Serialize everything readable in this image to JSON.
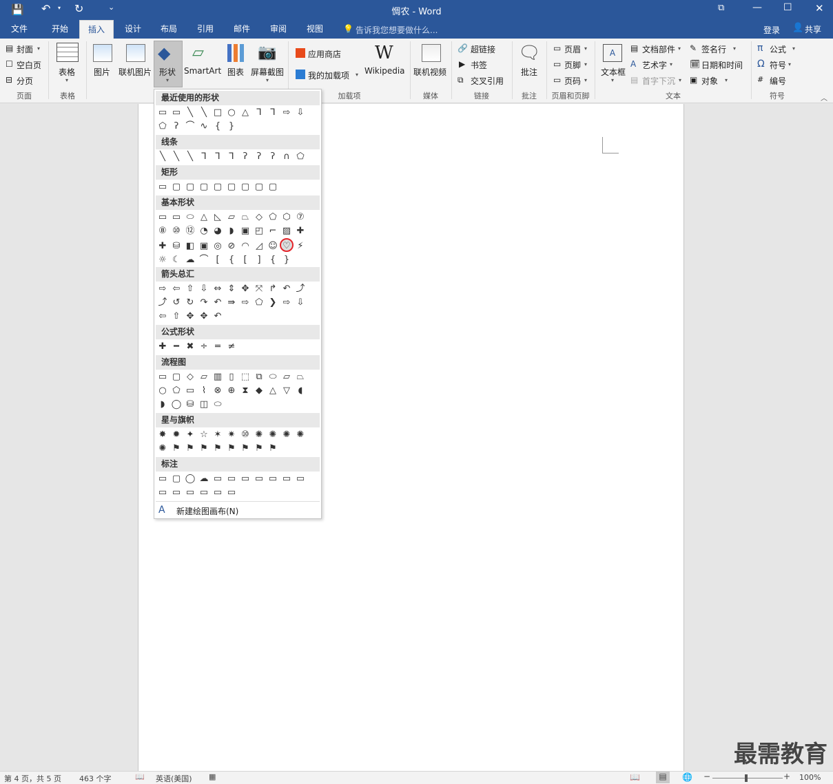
{
  "window": {
    "title": "惆农 - Word"
  },
  "titlebar": {
    "undo_icon": "undo-icon",
    "redo_icon": "redo-icon"
  },
  "tabs": [
    "文件",
    "开始",
    "插入",
    "设计",
    "布局",
    "引用",
    "邮件",
    "审阅",
    "视图"
  ],
  "tell_me": "告诉我您想要做什么...",
  "account": {
    "login": "登录",
    "share": "共享"
  },
  "ribbon": {
    "pages": {
      "cover": "封面",
      "blank": "空白页",
      "break": "分页",
      "label": "页面"
    },
    "tables": {
      "table": "表格",
      "label": "表格"
    },
    "illustrations": {
      "picture": "图片",
      "online_picture": "联机图片",
      "shapes": "形状",
      "smartart": "SmartArt",
      "chart": "图表",
      "screenshot": "屏幕截图"
    },
    "addins": {
      "store": "应用商店",
      "my_addins": "我的加载项",
      "wikipedia": "Wikipedia",
      "label": "加载项"
    },
    "media": {
      "online_video": "联机视频",
      "label": "媒体"
    },
    "links": {
      "hyperlink": "超链接",
      "bookmark": "书签",
      "cross_ref": "交叉引用",
      "label": "链接"
    },
    "comments": {
      "comment": "批注",
      "label": "批注"
    },
    "header_footer": {
      "header": "页眉",
      "footer": "页脚",
      "page_number": "页码",
      "label": "页眉和页脚"
    },
    "text": {
      "textbox": "文本框",
      "quick_parts": "文档部件",
      "wordart": "艺术字",
      "dropcap": "首字下沉",
      "signature": "签名行",
      "datetime": "日期和时间",
      "object": "对象",
      "label": "文本"
    },
    "symbols": {
      "equation": "公式",
      "symbol": "符号",
      "number": "编号",
      "label": "符号"
    }
  },
  "shapes_menu": {
    "sections": [
      "最近使用的形状",
      "线条",
      "矩形",
      "基本形状",
      "箭头总汇",
      "公式形状",
      "流程图",
      "星与旗帜",
      "标注"
    ],
    "recent": [
      "▭",
      "▭",
      "╲",
      "╲",
      "□",
      "○",
      "△",
      "⅂",
      "⅂",
      "⇨",
      "⇩",
      "⬠",
      "ʔ",
      "⌒",
      "∿",
      "{",
      "}"
    ],
    "lines": [
      "╲",
      "╲",
      "╲",
      "⅂",
      "⅂",
      "⅂",
      "ʔ",
      "ʔ",
      "ʔ",
      "∩",
      "⬠",
      "ʔ"
    ],
    "rectangles": [
      "▭",
      "▢",
      "▢",
      "▢",
      "▢",
      "▢",
      "▢",
      "▢",
      "▢"
    ],
    "basic": [
      "▭",
      "▭",
      "⬭",
      "△",
      "◺",
      "▱",
      "⏢",
      "◇",
      "⬠",
      "⬡",
      "⑦",
      "⑧",
      "⑩",
      "⑫",
      "◔",
      "◕",
      "◗",
      "▣",
      "◰",
      "⌐",
      "▨",
      "✚",
      "✚",
      "⛁",
      "◧",
      "▣",
      "◎",
      "⊘",
      "◠",
      "◿",
      "☺",
      "♡",
      "⚡",
      "☼",
      "☾",
      "☁",
      "⌒",
      "[",
      "{",
      "[",
      "]",
      "{",
      "}"
    ],
    "arrows": [
      "⇨",
      "⇦",
      "⇧",
      "⇩",
      "⇔",
      "⇕",
      "✥",
      "⤧",
      "↱",
      "↶",
      "⤴",
      "⤴",
      "↺",
      "↻",
      "↷",
      "↶",
      "⇛",
      "⇨",
      "⬠",
      "❯",
      "⇨",
      "⇩",
      "⇦",
      "⇧",
      "✥",
      "✥",
      "↶"
    ],
    "equation": [
      "✚",
      "━",
      "✖",
      "÷",
      "═",
      "≠"
    ],
    "flowchart": [
      "▭",
      "▢",
      "◇",
      "▱",
      "▥",
      "▯",
      "⬚",
      "⧉",
      "⬭",
      "⏥",
      "⏢",
      "○",
      "⬠",
      "▭",
      "⌇",
      "⊗",
      "⊕",
      "⧗",
      "◆",
      "△",
      "▽",
      "◖",
      "◗",
      "◯",
      "⛁",
      "◫",
      "⬭"
    ],
    "stars": [
      "✸",
      "✹",
      "✦",
      "☆",
      "✶",
      "✷",
      "⑩",
      "✺",
      "✺",
      "✺",
      "✺",
      "✺",
      "⚑",
      "⚑",
      "⚑",
      "⚑",
      "⚑",
      "⚑",
      "⚑",
      "⚑"
    ],
    "callouts": [
      "▭",
      "▢",
      "◯",
      "☁",
      "▭",
      "▭",
      "▭",
      "▭",
      "▭",
      "▭",
      "▭",
      "▭",
      "▭",
      "▭",
      "▭",
      "▭",
      "▭"
    ],
    "new_canvas": "新建绘图画布(N)",
    "highlight_index": 31
  },
  "status": {
    "page": "第 4 页，共 5 页",
    "words": "463 个字",
    "language": "英语(美国)",
    "zoom": "100%"
  },
  "watermark": "最需教育"
}
